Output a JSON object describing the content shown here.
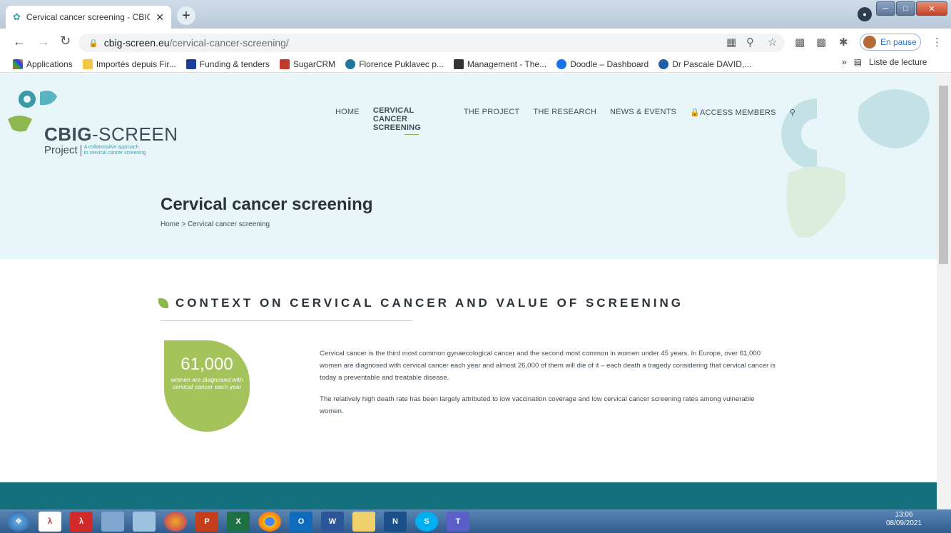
{
  "browser": {
    "tab_title": "Cervical cancer screening - CBIG-",
    "url_domain": "cbig-screen.eu",
    "url_path": "/cervical-cancer-screening/",
    "profile_status": "En pause"
  },
  "bookmarks": [
    "Applications",
    "Importés depuis Fir...",
    "Funding & tenders",
    "SugarCRM",
    "Florence Puklavec p...",
    "Management - The...",
    "Doodle – Dashboard",
    "Dr Pascale DAVID,..."
  ],
  "reading_list": "Liste de lecture",
  "site": {
    "logo_brand": "CBIG",
    "logo_brand_suffix": "-SCREEN",
    "logo_project": "Project",
    "logo_tagline_1": "A collaborative approach",
    "logo_tagline_2": "to cervical cancer screening",
    "nav": {
      "home": "HOME",
      "cervical": "CERVICAL CANCER SCREENING",
      "project": "THE PROJECT",
      "research": "THE RESEARCH",
      "news": "NEWS & EVENTS",
      "access": "ACCESS MEMBERS"
    },
    "page_title": "Cervical cancer screening",
    "breadcrumb": "Home > Cervical cancer screening",
    "section_heading": "CONTEXT ON CERVICAL CANCER AND VALUE OF SCREENING",
    "stat_number": "61,000",
    "stat_caption": "women are diagnosed with cervical cancer each year",
    "paragraph_1": "Cervical cancer is the third most common gynaecological cancer and the second most common in women under 45 years. In Europe, over 61,000 women are diagnosed with cervical cancer each year and almost 26,000 of them will die of it – each death a tragedy considering that cervical cancer is today a preventable and treatable disease.",
    "paragraph_2": "The relatively high death rate has been largely attributed to low vaccination coverage and low cervical cancer screening rates among vulnerable women."
  },
  "taskbar": {
    "time": "13:06",
    "date": "08/09/2021"
  },
  "colors": {
    "accent_green": "#8db850",
    "hero_bg": "#e9f6f9",
    "teal": "#14707d"
  }
}
